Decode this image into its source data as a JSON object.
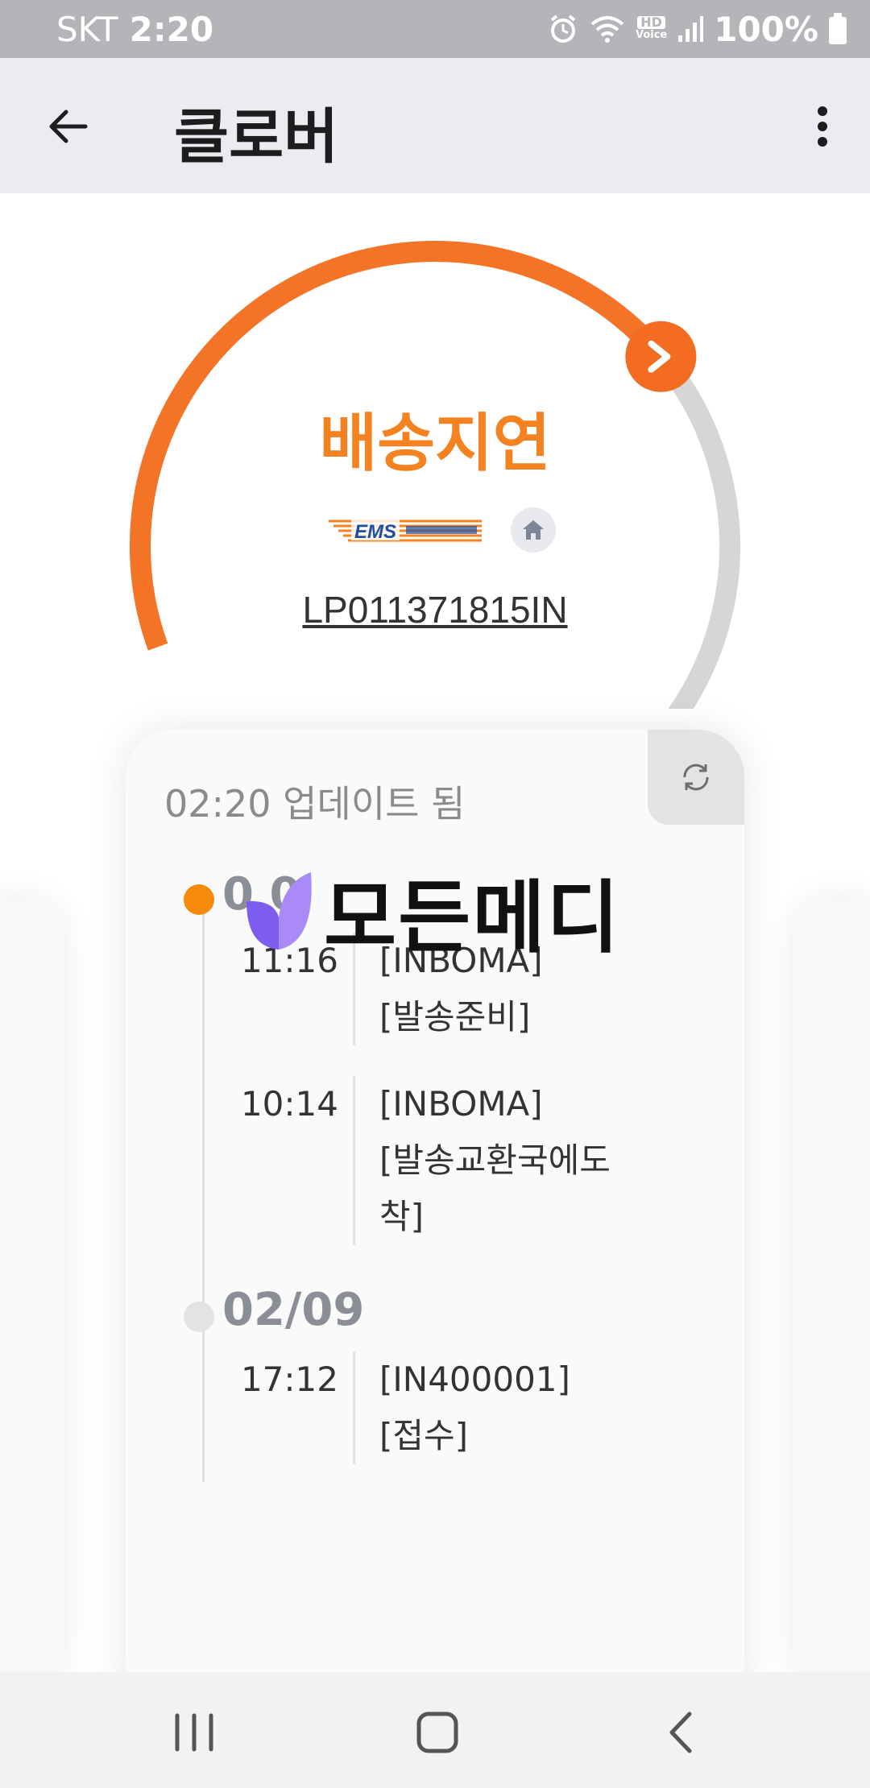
{
  "status_bar": {
    "carrier": "SKT",
    "time": "2:20",
    "hd_label": "HD",
    "voice_label": "Voice",
    "battery": "100%"
  },
  "app_bar": {
    "title": "클로버",
    "back_icon": "arrow-left-icon",
    "menu_icon": "more-vert-icon"
  },
  "delivery": {
    "status": "배송지연",
    "carrier_logo_text": "EMS",
    "tracking_number": "LP011371815IN",
    "progress": 0.5,
    "accent_color": "#f47427",
    "track_color": "#d6d6d6"
  },
  "card": {
    "updated": "02:20 업데이트 됨",
    "refresh_icon": "refresh-icon",
    "groups": [
      {
        "date": "0 0",
        "events": [
          {
            "time": "11:16",
            "location": "[INBOMA]",
            "detail": "[발송준비]"
          },
          {
            "time": "10:14",
            "location": "[INBOMA]",
            "detail": "[발송교환국에도착]"
          }
        ]
      },
      {
        "date": "02/09",
        "events": [
          {
            "time": "17:12",
            "location": "[IN400001]",
            "detail": "[접수]"
          }
        ]
      }
    ]
  },
  "watermark": {
    "text": "모든메디"
  },
  "nav_bar": {
    "recent_icon": "recent-apps-icon",
    "home_icon": "home-icon",
    "back_icon": "back-icon"
  }
}
